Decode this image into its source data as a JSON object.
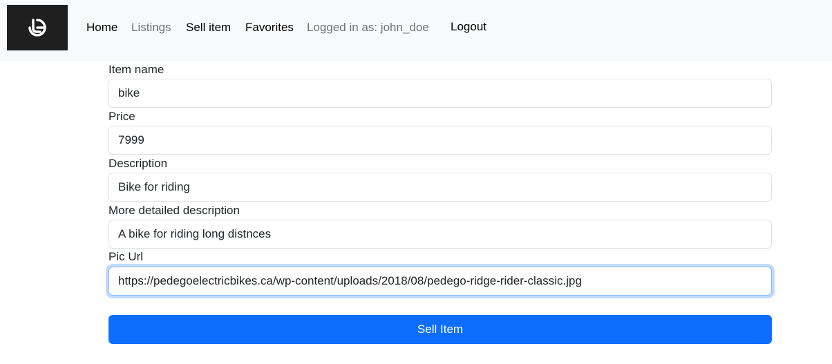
{
  "nav": {
    "home": "Home",
    "listings": "Listings",
    "sell_item": "Sell item",
    "favorites": "Favorites",
    "logged_in": "Logged in as: john_doe",
    "logout": "Logout"
  },
  "form": {
    "item_name": {
      "label": "Item name",
      "value": "bike"
    },
    "price": {
      "label": "Price",
      "value": "7999"
    },
    "description": {
      "label": "Description",
      "value": "Bike for riding"
    },
    "detailed_description": {
      "label": "More detailed description",
      "value": "A bike for riding long distnces"
    },
    "pic_url": {
      "label": "Pic Url",
      "value": "https://pedegoelectricbikes.ca/wp-content/uploads/2018/08/pedego-ridge-rider-classic.jpg"
    },
    "submit_label": "Sell Item"
  },
  "colors": {
    "primary": "#0d6efd",
    "navbar_bg": "#f8f9fa",
    "logo_bg": "#1f1f1f"
  }
}
